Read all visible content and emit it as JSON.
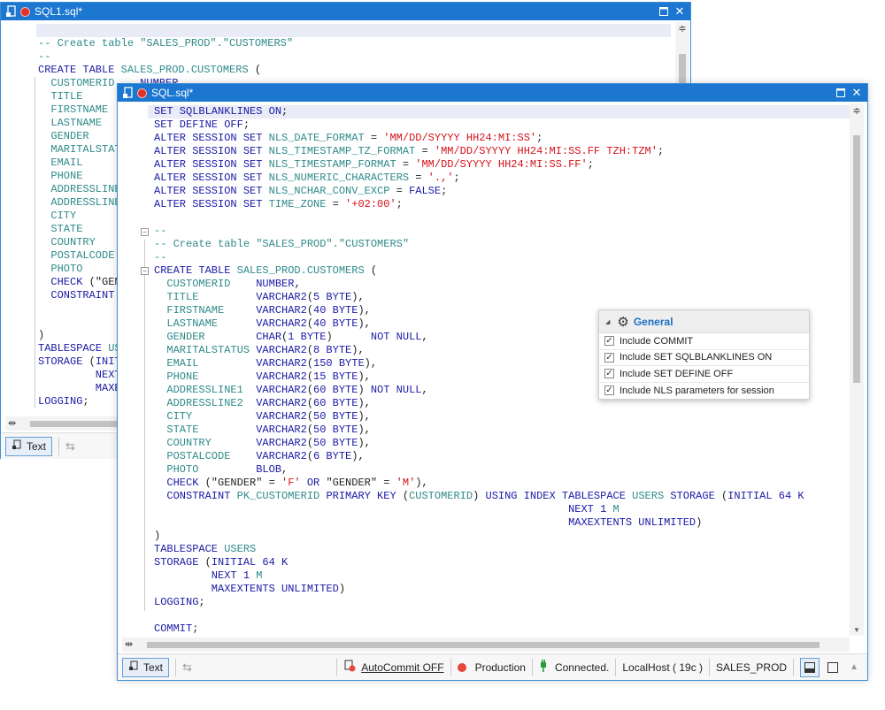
{
  "back": {
    "title": "SQL1.sql*"
  },
  "front": {
    "title": "SQL.sql*"
  },
  "toolbar": {
    "text_label": "Text"
  },
  "status": {
    "autocommit": "AutoCommit OFF",
    "env": "Production",
    "conn": "Connected.",
    "host": "LocalHost ( 19c )",
    "schema": "SALES_PROD"
  },
  "popup": {
    "title": "General",
    "options": [
      "Include COMMIT",
      "Include SET SQLBLANKLINES ON",
      "Include SET DEFINE OFF",
      "Include NLS parameters for session"
    ]
  },
  "colors": {
    "titlebar": "#1b77d0",
    "keyword": "#1a1aa6",
    "string": "#d4131a",
    "comment": "#2f8a8a",
    "production": "#e5473b",
    "connected": "#2a9d3a"
  },
  "back_code": [
    [
      [
        "c",
        "--"
      ]
    ],
    [
      [
        "c",
        "-- Create table \"SALES_PROD\".\"CUSTOMERS\""
      ]
    ],
    [
      [
        "c",
        "--"
      ]
    ],
    [
      [
        "k",
        "CREATE TABLE "
      ],
      [
        "i",
        "SALES_PROD.CUSTOMERS"
      ],
      [
        "p",
        " ("
      ]
    ],
    [
      [
        "i",
        "  CUSTOMERID"
      ],
      [
        "k",
        "    NUMBER,"
      ]
    ],
    [
      [
        "i",
        "  TITLE"
      ]
    ],
    [
      [
        "i",
        "  FIRSTNAME"
      ]
    ],
    [
      [
        "i",
        "  LASTNAME"
      ]
    ],
    [
      [
        "i",
        "  GENDER"
      ]
    ],
    [
      [
        "i",
        "  MARITALSTATUS"
      ]
    ],
    [
      [
        "i",
        "  EMAIL"
      ]
    ],
    [
      [
        "i",
        "  PHONE"
      ]
    ],
    [
      [
        "i",
        "  ADDRESSLINE1"
      ]
    ],
    [
      [
        "i",
        "  ADDRESSLINE2"
      ]
    ],
    [
      [
        "i",
        "  CITY"
      ]
    ],
    [
      [
        "i",
        "  STATE"
      ]
    ],
    [
      [
        "i",
        "  COUNTRY"
      ]
    ],
    [
      [
        "i",
        "  POSTALCODE"
      ]
    ],
    [
      [
        "i",
        "  PHOTO"
      ]
    ],
    [
      [
        "k",
        "  CHECK "
      ],
      [
        "p",
        "(\"GENDER\""
      ]
    ],
    [
      [
        "k",
        "  CONSTRAINT"
      ]
    ],
    [
      [
        "p",
        ""
      ]
    ],
    [
      [
        "p",
        ""
      ]
    ],
    [
      [
        "p",
        ")"
      ]
    ],
    [
      [
        "k",
        "TABLESPACE "
      ],
      [
        "i",
        "USERS"
      ]
    ],
    [
      [
        "k",
        "STORAGE "
      ],
      [
        "p",
        "("
      ],
      [
        "k",
        "INITIAL"
      ]
    ],
    [
      [
        "k",
        "         NEXT"
      ]
    ],
    [
      [
        "k",
        "         MAXEXTENTS"
      ]
    ],
    [
      [
        "k",
        "LOGGING"
      ],
      [
        "p",
        ";"
      ]
    ]
  ],
  "front_code": [
    [
      [
        "k",
        "SET SQLBLANKLINES ON"
      ],
      [
        "p",
        ";"
      ]
    ],
    [
      [
        "k",
        "SET DEFINE OFF"
      ],
      [
        "p",
        ";"
      ]
    ],
    [
      [
        "k",
        "ALTER SESSION SET "
      ],
      [
        "i",
        "NLS_DATE_FORMAT"
      ],
      [
        "p",
        " = "
      ],
      [
        "s",
        "'MM/DD/SYYYY HH24:MI:SS'"
      ],
      [
        "p",
        ";"
      ]
    ],
    [
      [
        "k",
        "ALTER SESSION SET "
      ],
      [
        "i",
        "NLS_TIMESTAMP_TZ_FORMAT"
      ],
      [
        "p",
        " = "
      ],
      [
        "s",
        "'MM/DD/SYYYY HH24:MI:SS.FF TZH:TZM'"
      ],
      [
        "p",
        ";"
      ]
    ],
    [
      [
        "k",
        "ALTER SESSION SET "
      ],
      [
        "i",
        "NLS_TIMESTAMP_FORMAT"
      ],
      [
        "p",
        " = "
      ],
      [
        "s",
        "'MM/DD/SYYYY HH24:MI:SS.FF'"
      ],
      [
        "p",
        ";"
      ]
    ],
    [
      [
        "k",
        "ALTER SESSION SET "
      ],
      [
        "i",
        "NLS_NUMERIC_CHARACTERS"
      ],
      [
        "p",
        " = "
      ],
      [
        "s",
        "'.,'"
      ],
      [
        "p",
        ";"
      ]
    ],
    [
      [
        "k",
        "ALTER SESSION SET "
      ],
      [
        "i",
        "NLS_NCHAR_CONV_EXCP"
      ],
      [
        "p",
        " = "
      ],
      [
        "k",
        "FALSE"
      ],
      [
        "p",
        ";"
      ]
    ],
    [
      [
        "k",
        "ALTER SESSION SET "
      ],
      [
        "i",
        "TIME_ZONE"
      ],
      [
        "p",
        " = "
      ],
      [
        "s",
        "'+02:00'"
      ],
      [
        "p",
        ";"
      ]
    ],
    [
      [
        "p",
        ""
      ]
    ],
    [
      [
        "c",
        "--"
      ]
    ],
    [
      [
        "c",
        "-- Create table \"SALES_PROD\".\"CUSTOMERS\""
      ]
    ],
    [
      [
        "c",
        "--"
      ]
    ],
    [
      [
        "k",
        "CREATE TABLE "
      ],
      [
        "i",
        "SALES_PROD.CUSTOMERS"
      ],
      [
        "p",
        " ("
      ]
    ],
    [
      [
        "i",
        "  CUSTOMERID    "
      ],
      [
        "k",
        "NUMBER"
      ],
      [
        "p",
        ","
      ]
    ],
    [
      [
        "i",
        "  TITLE         "
      ],
      [
        "k",
        "VARCHAR2"
      ],
      [
        "p",
        "("
      ],
      [
        "k",
        "5 BYTE"
      ],
      [
        "p",
        "),"
      ]
    ],
    [
      [
        "i",
        "  FIRSTNAME     "
      ],
      [
        "k",
        "VARCHAR2"
      ],
      [
        "p",
        "("
      ],
      [
        "k",
        "40 BYTE"
      ],
      [
        "p",
        "),"
      ]
    ],
    [
      [
        "i",
        "  LASTNAME      "
      ],
      [
        "k",
        "VARCHAR2"
      ],
      [
        "p",
        "("
      ],
      [
        "k",
        "40 BYTE"
      ],
      [
        "p",
        "),"
      ]
    ],
    [
      [
        "i",
        "  GENDER        "
      ],
      [
        "k",
        "CHAR"
      ],
      [
        "p",
        "("
      ],
      [
        "k",
        "1 BYTE"
      ],
      [
        "p",
        ")      "
      ],
      [
        "k",
        "NOT NULL"
      ],
      [
        "p",
        ","
      ]
    ],
    [
      [
        "i",
        "  MARITALSTATUS "
      ],
      [
        "k",
        "VARCHAR2"
      ],
      [
        "p",
        "("
      ],
      [
        "k",
        "8 BYTE"
      ],
      [
        "p",
        "),"
      ]
    ],
    [
      [
        "i",
        "  EMAIL         "
      ],
      [
        "k",
        "VARCHAR2"
      ],
      [
        "p",
        "("
      ],
      [
        "k",
        "150 BYTE"
      ],
      [
        "p",
        "),"
      ]
    ],
    [
      [
        "i",
        "  PHONE         "
      ],
      [
        "k",
        "VARCHAR2"
      ],
      [
        "p",
        "("
      ],
      [
        "k",
        "15 BYTE"
      ],
      [
        "p",
        "),"
      ]
    ],
    [
      [
        "i",
        "  ADDRESSLINE1  "
      ],
      [
        "k",
        "VARCHAR2"
      ],
      [
        "p",
        "("
      ],
      [
        "k",
        "60 BYTE"
      ],
      [
        "p",
        ") "
      ],
      [
        "k",
        "NOT NULL"
      ],
      [
        "p",
        ","
      ]
    ],
    [
      [
        "i",
        "  ADDRESSLINE2  "
      ],
      [
        "k",
        "VARCHAR2"
      ],
      [
        "p",
        "("
      ],
      [
        "k",
        "60 BYTE"
      ],
      [
        "p",
        "),"
      ]
    ],
    [
      [
        "i",
        "  CITY          "
      ],
      [
        "k",
        "VARCHAR2"
      ],
      [
        "p",
        "("
      ],
      [
        "k",
        "50 BYTE"
      ],
      [
        "p",
        "),"
      ]
    ],
    [
      [
        "i",
        "  STATE         "
      ],
      [
        "k",
        "VARCHAR2"
      ],
      [
        "p",
        "("
      ],
      [
        "k",
        "50 BYTE"
      ],
      [
        "p",
        "),"
      ]
    ],
    [
      [
        "i",
        "  COUNTRY       "
      ],
      [
        "k",
        "VARCHAR2"
      ],
      [
        "p",
        "("
      ],
      [
        "k",
        "50 BYTE"
      ],
      [
        "p",
        "),"
      ]
    ],
    [
      [
        "i",
        "  POSTALCODE    "
      ],
      [
        "k",
        "VARCHAR2"
      ],
      [
        "p",
        "("
      ],
      [
        "k",
        "6 BYTE"
      ],
      [
        "p",
        "),"
      ]
    ],
    [
      [
        "i",
        "  PHOTO         "
      ],
      [
        "k",
        "BLOB"
      ],
      [
        "p",
        ","
      ]
    ],
    [
      [
        "k",
        "  CHECK "
      ],
      [
        "p",
        "(\"GENDER\" = "
      ],
      [
        "s",
        "'F'"
      ],
      [
        "k",
        " OR "
      ],
      [
        "p",
        "\"GENDER\" = "
      ],
      [
        "s",
        "'M'"
      ],
      [
        "p",
        "),"
      ]
    ],
    [
      [
        "k",
        "  CONSTRAINT "
      ],
      [
        "i",
        "PK_CUSTOMERID"
      ],
      [
        "k",
        " PRIMARY KEY "
      ],
      [
        "p",
        "("
      ],
      [
        "i",
        "CUSTOMERID"
      ],
      [
        "p",
        ") "
      ],
      [
        "k",
        "USING INDEX TABLESPACE "
      ],
      [
        "i",
        "USERS"
      ],
      [
        "k",
        " STORAGE "
      ],
      [
        "p",
        "("
      ],
      [
        "k",
        "INITIAL 64 K"
      ]
    ],
    [
      [
        "p",
        "                                                                 "
      ],
      [
        "k",
        "NEXT 1 "
      ],
      [
        "i",
        "M"
      ]
    ],
    [
      [
        "p",
        "                                                                 "
      ],
      [
        "k",
        "MAXEXTENTS UNLIMITED"
      ],
      [
        "p",
        ")"
      ]
    ],
    [
      [
        "p",
        ")"
      ]
    ],
    [
      [
        "k",
        "TABLESPACE "
      ],
      [
        "i",
        "USERS"
      ]
    ],
    [
      [
        "k",
        "STORAGE "
      ],
      [
        "p",
        "("
      ],
      [
        "k",
        "INITIAL 64 K"
      ]
    ],
    [
      [
        "k",
        "         NEXT 1 "
      ],
      [
        "i",
        "M"
      ]
    ],
    [
      [
        "k",
        "         MAXEXTENTS UNLIMITED"
      ],
      [
        "p",
        ")"
      ]
    ],
    [
      [
        "k",
        "LOGGING"
      ],
      [
        "p",
        ";"
      ]
    ],
    [
      [
        "p",
        ""
      ]
    ],
    [
      [
        "k",
        "COMMIT"
      ],
      [
        "p",
        ";"
      ]
    ]
  ]
}
